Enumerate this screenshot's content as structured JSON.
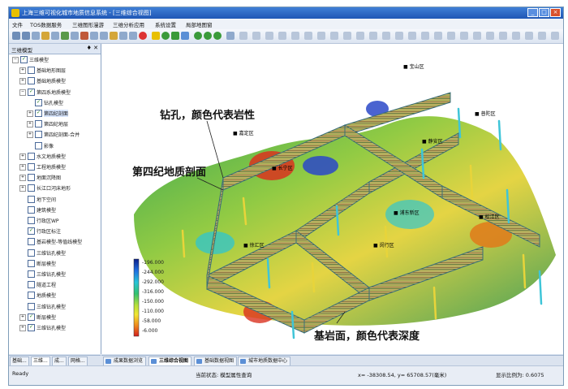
{
  "window": {
    "title": "上海三维可视化城市地质信息系统 - [三维综合视图]",
    "controls": [
      "_",
      "□",
      "×"
    ]
  },
  "menu": [
    {
      "label": "文件"
    },
    {
      "label": "TOS数据服务"
    },
    {
      "label": "三维图形漫游"
    },
    {
      "label": "三维分析应用"
    },
    {
      "label": "系统设置"
    },
    {
      "label": "局部地图窗"
    }
  ],
  "left_panel": {
    "title": "三维模型",
    "controls": "♦ ✕",
    "tree": [
      {
        "label": "三维模型",
        "level": 0,
        "expander": "−",
        "checked": true
      },
      {
        "label": "基础地形图层",
        "level": 1,
        "expander": "+",
        "checked": false
      },
      {
        "label": "基础地质模型",
        "level": 1,
        "expander": "+",
        "checked": false
      },
      {
        "label": "第四系地质模型",
        "level": 1,
        "expander": "−",
        "checked": true
      },
      {
        "label": "钻孔模型",
        "level": 2,
        "expander": "",
        "checked": true
      },
      {
        "label": "第四纪剖面",
        "level": 2,
        "expander": "+",
        "checked": true,
        "highlight": true
      },
      {
        "label": "第四纪地层",
        "level": 2,
        "expander": "+",
        "checked": false
      },
      {
        "label": "第四纪剖面-合并",
        "level": 2,
        "expander": "+",
        "checked": false
      },
      {
        "label": "影像",
        "level": 2,
        "expander": "",
        "checked": false
      },
      {
        "label": "水文地质模型",
        "level": 1,
        "expander": "+",
        "checked": false
      },
      {
        "label": "工程地质模型",
        "level": 1,
        "expander": "+",
        "checked": false
      },
      {
        "label": "地面沉降图",
        "level": 1,
        "expander": "+",
        "checked": false
      },
      {
        "label": "长江口河床地形",
        "level": 1,
        "expander": "+",
        "checked": false
      },
      {
        "label": "地下空间",
        "level": 1,
        "expander": "",
        "checked": false
      },
      {
        "label": "建筑模型",
        "level": 1,
        "expander": "",
        "checked": false
      },
      {
        "label": "行政区WP",
        "level": 1,
        "expander": "",
        "checked": false
      },
      {
        "label": "行政区标注",
        "level": 1,
        "expander": "",
        "checked": true
      },
      {
        "label": "基岩模型-等值线模型",
        "level": 1,
        "expander": "",
        "checked": false
      },
      {
        "label": "三维钻孔模型",
        "level": 1,
        "expander": "",
        "checked": false
      },
      {
        "label": "断层模型",
        "level": 1,
        "expander": "",
        "checked": false
      },
      {
        "label": "三维钻孔模型",
        "level": 1,
        "expander": "",
        "checked": false
      },
      {
        "label": "隧道工程",
        "level": 1,
        "expander": "",
        "checked": false
      },
      {
        "label": "地质模型",
        "level": 1,
        "expander": "",
        "checked": false
      },
      {
        "label": "三维钻孔模型",
        "level": 1,
        "expander": "",
        "checked": false
      },
      {
        "label": "断层模型",
        "level": 1,
        "expander": "+",
        "checked": true
      },
      {
        "label": "三维钻孔模型",
        "level": 1,
        "expander": "+",
        "checked": true
      }
    ]
  },
  "left_tabs": [
    {
      "label": "基础..."
    },
    {
      "label": "三维...",
      "active": true
    },
    {
      "label": "成..."
    },
    {
      "label": "网格..."
    }
  ],
  "viewport": {
    "annotations": {
      "boreholes": "钻孔，颜色代表岩性",
      "quaternary": "第四纪地质剖面",
      "bedrock": "基岩面，颜色代表深度"
    },
    "place_labels": [
      {
        "text": "■ 宝山区"
      },
      {
        "text": "■ 嘉定区"
      },
      {
        "text": "■ 普陀区"
      },
      {
        "text": "■ 静安区"
      },
      {
        "text": "■ 长宁区"
      },
      {
        "text": "■ 浦东新区"
      },
      {
        "text": "■ 徐汇区"
      },
      {
        "text": "■ 闵行区"
      },
      {
        "text": "■ 松江区"
      }
    ],
    "legend": {
      "labels": [
        "-196.000",
        "-244.000",
        "-292.000",
        "-316.000",
        "-150.000",
        "-110.000",
        "-58.000",
        "-6.000"
      ],
      "colors": [
        "#0b1f8a",
        "#1f6fe0",
        "#27c4d8",
        "#33c26e",
        "#b6e03a",
        "#f2e633",
        "#f08a1c",
        "#d21f1f"
      ]
    }
  },
  "view_tabs": [
    {
      "label": "成果数据浏览"
    },
    {
      "label": "三维综合视图",
      "active": true
    },
    {
      "label": "基础数据视图"
    },
    {
      "label": "城市地质数据中心"
    }
  ],
  "status": {
    "ready": "Ready",
    "state": "当前状态: 模型属性查询",
    "coords": "x= -38308.54, y= 65708.57(毫米)",
    "scale": "显示比例为: 0.6075"
  }
}
